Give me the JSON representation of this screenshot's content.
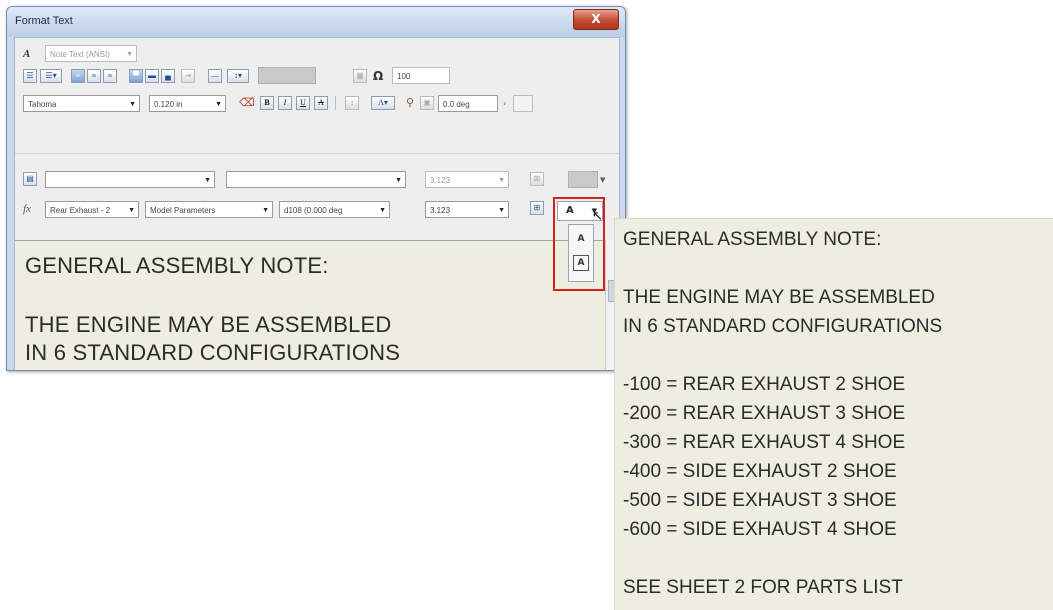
{
  "window": {
    "title": "Format Text",
    "close_label": "X"
  },
  "style_row": {
    "style_dropdown": "Note Text (ANSI)"
  },
  "para_row": {
    "symbol_label": "Ω",
    "stretch_value": "100"
  },
  "font_row": {
    "font_name": "Tahoma",
    "font_size": "0.120 in",
    "bold_label": "B",
    "italic_label": "I",
    "underline_label": "U",
    "strike_label": "A",
    "rotation_value": "0.0 deg"
  },
  "param_row1": {
    "value": "3.123"
  },
  "param_row2": {
    "component": "Rear Exhaust - 2",
    "source": "Model Parameters",
    "parameter": "d108 (0.000 deg",
    "value": "3.123"
  },
  "popup": {
    "current": "A",
    "items": [
      "A",
      "A"
    ]
  },
  "editor": {
    "lines": [
      "GENERAL ASSEMBLY NOTE:",
      "",
      "THE ENGINE MAY BE ASSEMBLED",
      "IN 6  STANDARD CONFIGURATIONS"
    ]
  },
  "note": {
    "lines": [
      "GENERAL ASSEMBLY NOTE:",
      "",
      "THE ENGINE MAY BE ASSEMBLED",
      "IN 6  STANDARD CONFIGURATIONS",
      "",
      "-100 = REAR EXHAUST 2 SHOE",
      "-200 = REAR EXHAUST 3 SHOE",
      "-300 = REAR EXHAUST 4 SHOE",
      "-400 = SIDE EXHAUST 2 SHOE",
      "-500 = SIDE EXHAUST 3 SHOE",
      "-600 = SIDE EXHAUST 4 SHOE",
      "",
      "SEE SHEET 2 FOR PARTS LIST"
    ]
  },
  "colors": {
    "highlight_box": "#d0231f",
    "note_background": "#eeeee0",
    "title_bar": "#bccde5"
  }
}
